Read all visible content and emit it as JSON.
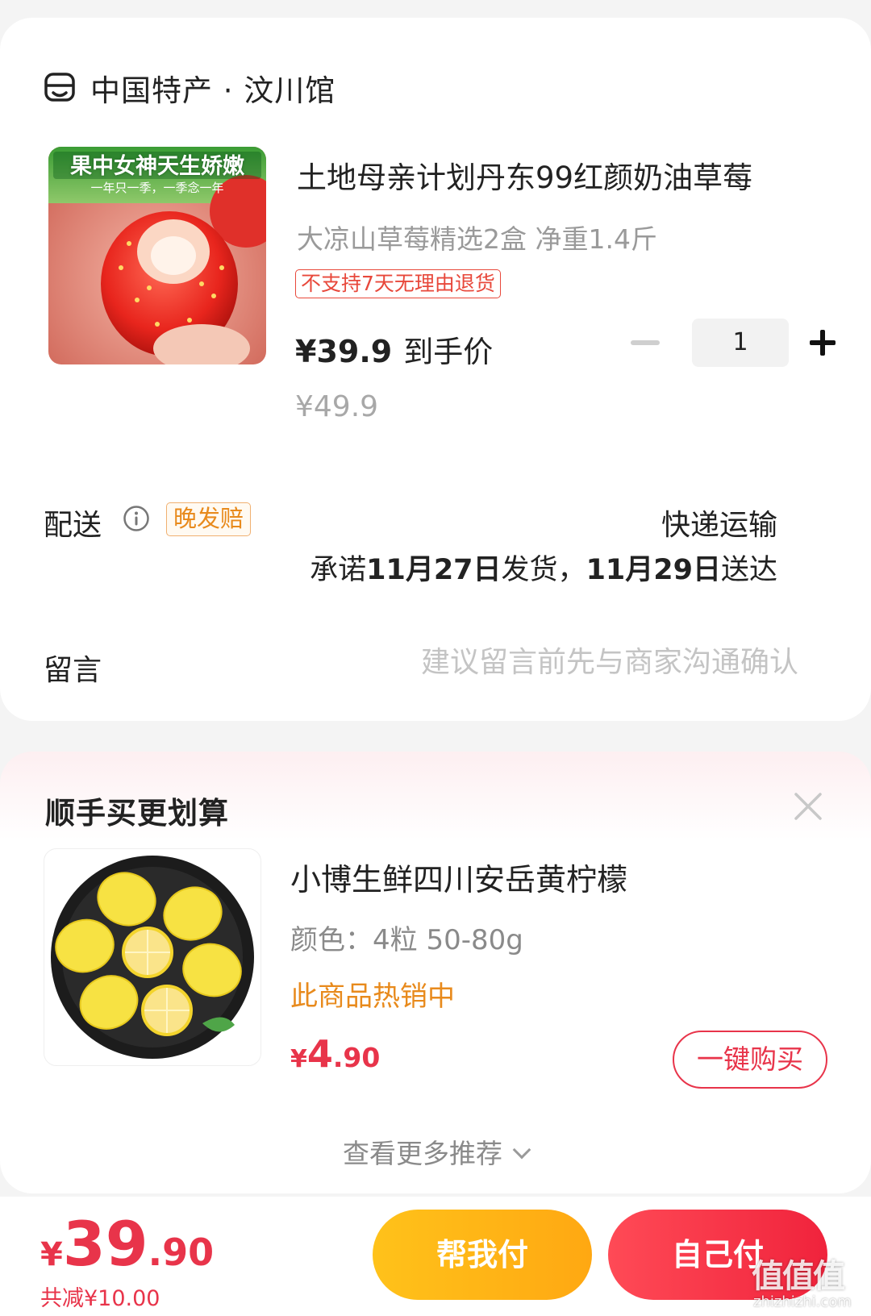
{
  "store": {
    "icon": "shop-icon",
    "name": "中国特产 · 汶川馆"
  },
  "product": {
    "image_banner": "果中女神天生娇嫩",
    "image_sub": "一年只一季，一季念一年",
    "title": "土地母亲计划丹东99红颜奶油草莓",
    "spec": "大凉山草莓精选2盒 净重1.4斤",
    "tag": "不支持7天无理由退货",
    "price_now": "¥39.9",
    "price_now_label": "到手价",
    "price_old": "¥49.9",
    "quantity": "1"
  },
  "delivery": {
    "label": "配送",
    "badge": "晚发赔",
    "method": "快递运输",
    "promise_prefix": "承诺",
    "ship_date": "11月27日",
    "promise_mid": "发货，",
    "arrive_date": "11月29日",
    "promise_suffix": "送达"
  },
  "message": {
    "label": "留言",
    "placeholder": "建议留言前先与商家沟通确认"
  },
  "recommend": {
    "title": "顺手买更划算",
    "item": {
      "name": "小博生鲜四川安岳黄柠檬",
      "spec": "颜色：4粒 50-80g",
      "hot": "此商品热销中",
      "price_symbol": "¥",
      "price_int": "4",
      "price_dec": ".90",
      "buy_label": "一键购买"
    },
    "more_label": "查看更多推荐"
  },
  "footer": {
    "total_symbol": "¥",
    "total_int": "39",
    "total_dec": ".90",
    "discount": "共减¥10.00",
    "help_pay": "帮我付",
    "self_pay": "自己付"
  },
  "watermark": {
    "main": "值值值",
    "sub": "zhizhizhi.com"
  },
  "colors": {
    "accent_red": "#e8344a",
    "orange": "#e88a1c",
    "yellow_btn": "#ffb514"
  }
}
